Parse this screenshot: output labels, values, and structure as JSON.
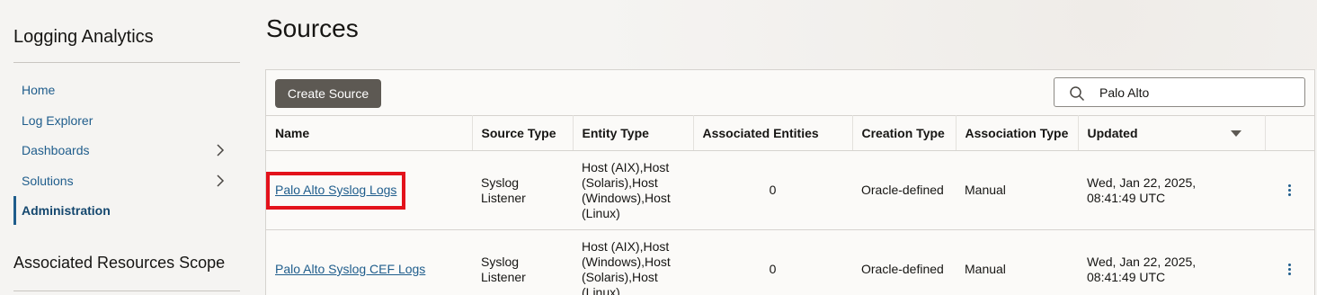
{
  "sidebar": {
    "app_title": "Logging Analytics",
    "items": [
      {
        "label": "Home",
        "has_chevron": false,
        "active": false
      },
      {
        "label": "Log Explorer",
        "has_chevron": false,
        "active": false
      },
      {
        "label": "Dashboards",
        "has_chevron": true,
        "active": false
      },
      {
        "label": "Solutions",
        "has_chevron": true,
        "active": false
      },
      {
        "label": "Administration",
        "has_chevron": false,
        "active": true
      }
    ],
    "scope_title": "Associated Resources Scope"
  },
  "main": {
    "title": "Sources",
    "create_label": "Create Source",
    "search": {
      "value": "Palo Alto",
      "icon": "search-icon"
    },
    "columns": [
      "Name",
      "Source Type",
      "Entity Type",
      "Associated Entities",
      "Creation Type",
      "Association Type",
      "Updated"
    ],
    "rows": [
      {
        "name": "Palo Alto Syslog Logs",
        "source_type_1": "Syslog",
        "source_type_2": "Listener",
        "entity_1": "Host (AIX),Host",
        "entity_2": "(Solaris),Host",
        "entity_3": "(Windows),Host",
        "entity_4": "(Linux)",
        "associated_entities": "0",
        "creation_type": "Oracle-defined",
        "association_type": "Manual",
        "updated_1": "Wed, Jan 22, 2025,",
        "updated_2": "08:41:49 UTC"
      },
      {
        "name": "Palo Alto Syslog CEF Logs",
        "source_type_1": "Syslog",
        "source_type_2": "Listener",
        "entity_1": "Host (AIX),Host",
        "entity_2": "(Windows),Host",
        "entity_3": "(Solaris),Host",
        "entity_4": "(Linux)",
        "associated_entities": "0",
        "creation_type": "Oracle-defined",
        "association_type": "Manual",
        "updated_1": "Wed, Jan 22, 2025,",
        "updated_2": "08:41:49 UTC"
      }
    ]
  },
  "colors": {
    "accent": "#1f5d8c",
    "button": "#5d5953",
    "highlight": "#e3121b"
  }
}
